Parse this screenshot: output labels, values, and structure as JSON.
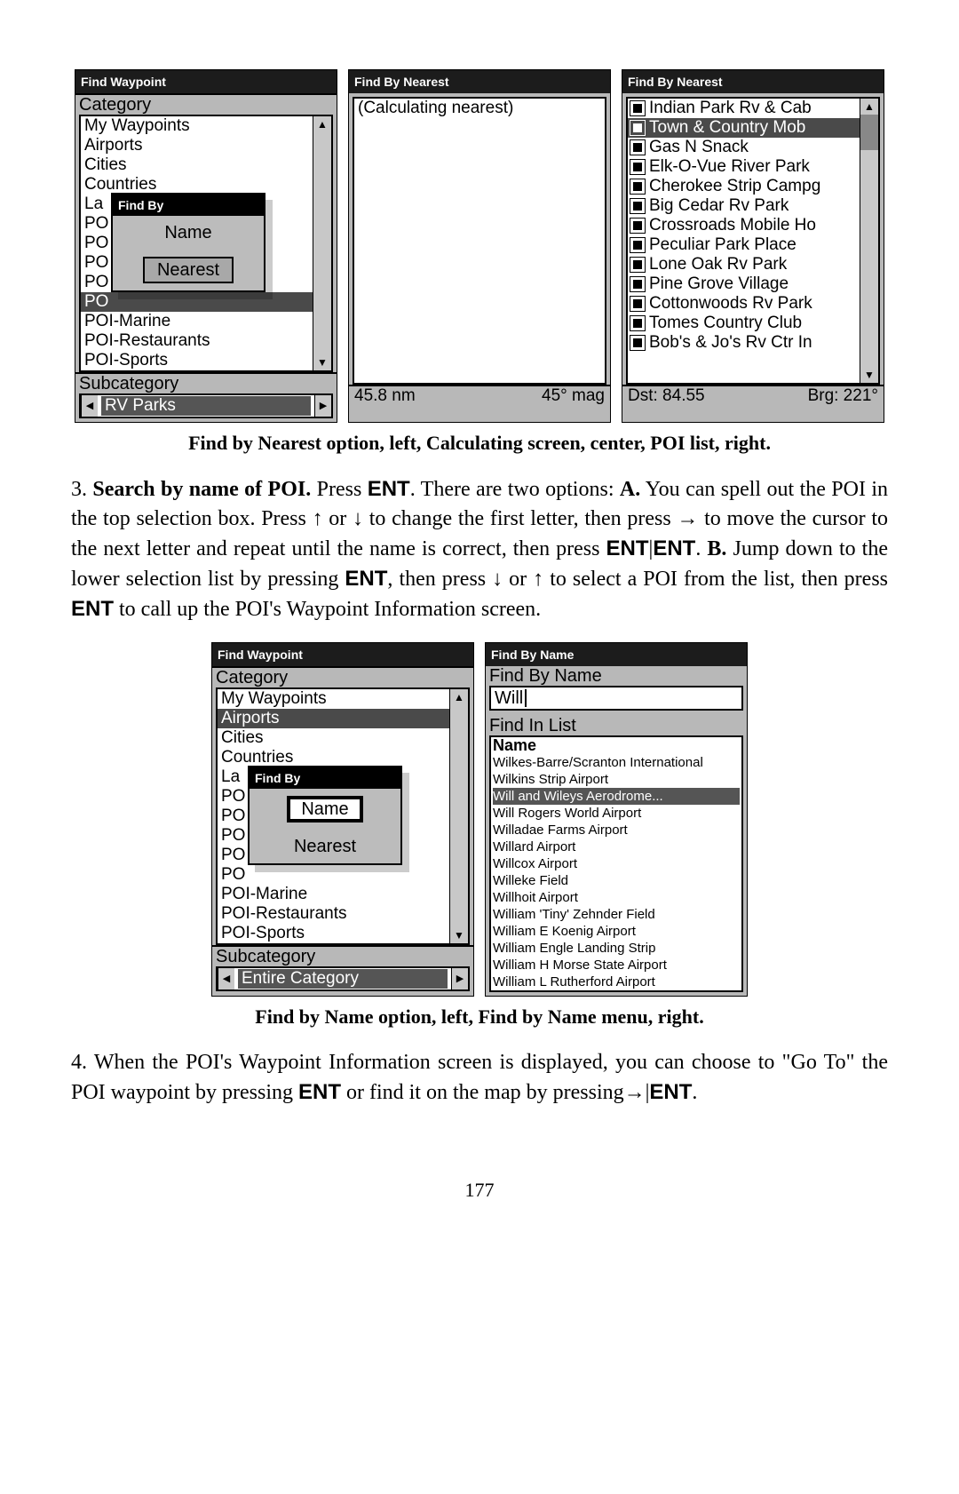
{
  "figure1": {
    "left": {
      "title": "Find Waypoint",
      "category_label": "Category",
      "items": [
        "My Waypoints",
        "Airports",
        "Cities",
        "Countries",
        "La",
        "PO",
        "PO",
        "PO",
        "PO",
        "PO",
        "POI-Marine",
        "POI-Restaurants",
        "POI-Sports"
      ],
      "popup": {
        "title": "Find By",
        "name": "Name",
        "nearest": "Nearest"
      },
      "subcategory_label": "Subcategory",
      "subcategory_value": "RV Parks"
    },
    "center": {
      "title": "Find By Nearest",
      "calc": "(Calculating nearest)",
      "dist": "45.8 nm",
      "mag": "45° mag"
    },
    "right": {
      "title": "Find By Nearest",
      "items": [
        "Indian Park Rv & Cab",
        "Town & Country Mob",
        "Gas N Snack",
        "Elk-O-Vue River Park",
        "Cherokee Strip Campg",
        "Big Cedar Rv Park",
        "Crossroads Mobile Ho",
        "Peculiar Park Place",
        "Lone Oak Rv Park",
        "Pine Grove Village",
        "Cottonwoods Rv Park",
        "Tomes Country Club",
        "Bob's & Jo's Rv Ctr In"
      ],
      "selected_index": 1,
      "dst": "Dst: 84.55",
      "brg": "Brg: 221°"
    },
    "caption": "Find by Nearest option, left, Calculating screen, center, POI list, right."
  },
  "para1": {
    "num": "3. ",
    "bold": "Search by name of POI.",
    "t1": " Press ",
    "k1": "ENT",
    "t2": ". There are two options: ",
    "a": "A.",
    "t3": " You can spell out the POI in the top selection box. Press ↑ or ↓ to change the first letter, then press → to move the cursor to the next letter and repeat until the name is correct, then press ",
    "k2": "ENT",
    "bar1": "|",
    "k3": "ENT",
    "t4": ". ",
    "b": "B.",
    "t5": " Jump down to the lower selection list by pressing ",
    "k4": "ENT",
    "t6": ", then press ↓ or ↑ to select a POI from the list, then press ",
    "k5": "ENT",
    "t7": " to call up the POI's Waypoint Information screen."
  },
  "figure2": {
    "left": {
      "title": "Find Waypoint",
      "category_label": "Category",
      "items": [
        "My Waypoints",
        "Airports",
        "Cities",
        "Countries",
        "La",
        "PO",
        "PO",
        "PO",
        "PO",
        "PO",
        "POI-Marine",
        "POI-Restaurants",
        "POI-Sports"
      ],
      "selected_index": 1,
      "popup": {
        "title": "Find By",
        "name": "Name",
        "nearest": "Nearest"
      },
      "subcategory_label": "Subcategory",
      "subcategory_value": "Entire Category"
    },
    "right": {
      "title": "Find By Name",
      "findbyname_label": "Find By Name",
      "input": "Will",
      "findinlist_label": "Find In List",
      "name_header": "Name",
      "items": [
        "Wilkes-Barre/Scranton International",
        "Wilkins Strip Airport",
        "Will and Wileys Aerodrome...",
        "Will Rogers World Airport",
        "Willadae Farms Airport",
        "Willard Airport",
        "Willcox Airport",
        "Willeke Field",
        "Willhoit Airport",
        "William 'Tiny' Zehnder Field",
        "William E Koenig Airport",
        "William Engle Landing Strip",
        "William H Morse State Airport",
        "William L Rutherford Airport"
      ],
      "selected_index": 2
    },
    "caption": "Find by Name option, left, Find by Name menu, right."
  },
  "para2": {
    "t1": "4. When the POI's Waypoint Information screen is displayed, you can choose to \"Go To\" the POI waypoint by pressing ",
    "k1": "ENT",
    "t2": " or find it on the map by pressing→|",
    "k2": "ENT",
    "t3": "."
  },
  "page": "177"
}
